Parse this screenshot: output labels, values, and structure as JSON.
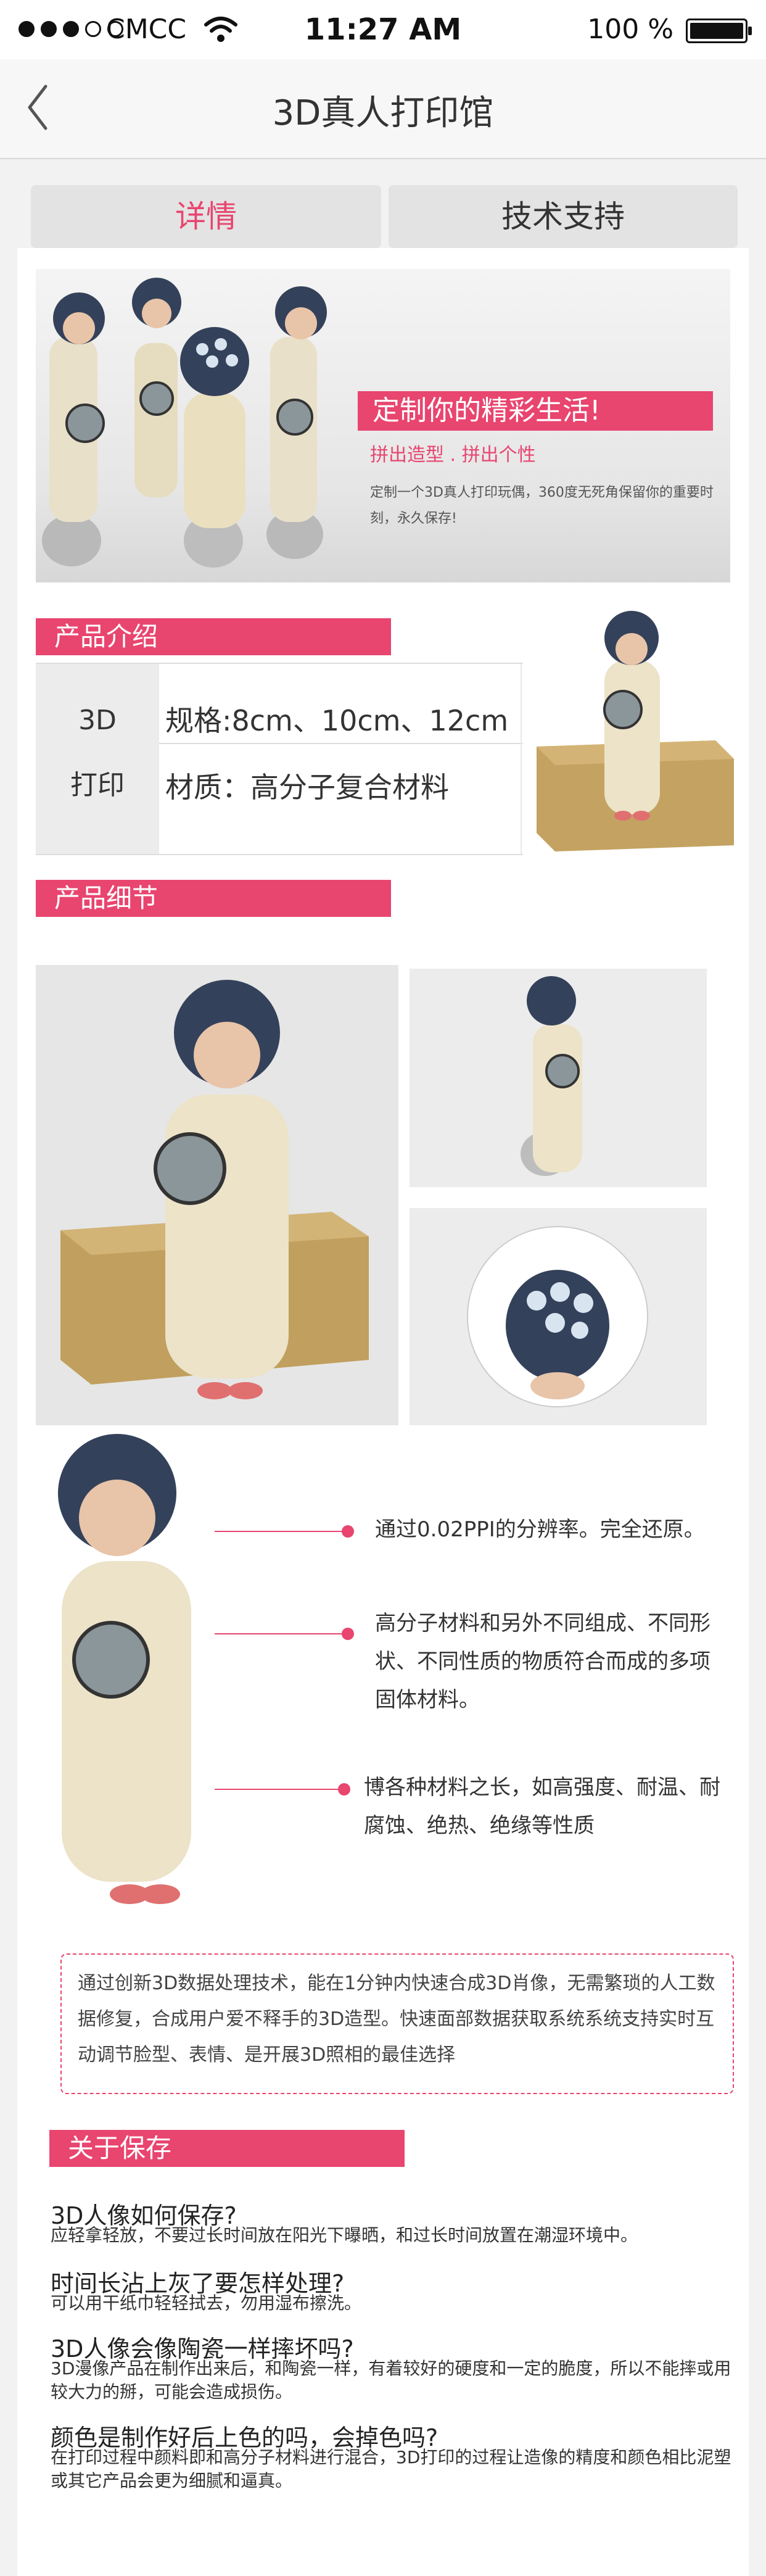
{
  "status_bar": {
    "carrier": "CMCC",
    "time": "11:27 AM",
    "battery": "100 %"
  },
  "nav": {
    "title": "3D真人打印馆"
  },
  "tabs": [
    {
      "label": "详情",
      "active": true
    },
    {
      "label": "技术支持",
      "active": false
    }
  ],
  "hero": {
    "slogan": "定制你的精彩生活!",
    "subtitle": "拼出造型 . 拼出个性",
    "description": "定制一个3D真人打印玩偶，360度无死角保留你的重要时刻，永久保存!"
  },
  "product_intro": {
    "header": "产品介绍",
    "label_line1": "3D",
    "label_line2": "打印",
    "spec_size": "规格:8cm、10cm、12cm",
    "spec_material": "材质：高分子复合材料"
  },
  "product_detail": {
    "header": "产品细节"
  },
  "features": [
    "通过0.02PPI的分辨率。完全还原。",
    "高分子材料和另外不同组成、不同形状、不同性质的物质符合而成的多项固体材料。",
    "博各种材料之长，如高强度、耐温、耐腐蚀、绝热、绝缘等性质"
  ],
  "note": "通过创新3D数据处理技术，能在1分钟内快速合成3D肖像，无需繁琐的人工数据修复，合成用户爱不释手的3D造型。快速面部数据获取系统系统支持实时互动调节脸型、表情、是开展3D照相的最佳选择",
  "storage": {
    "header": "关于保存",
    "qa": [
      {
        "q": "3D人像如何保存?",
        "a": "应轻拿轻放，不要过长时间放在阳光下曝晒，和过长时间放置在潮湿环境中。"
      },
      {
        "q": "时间长沾上灰了要怎样处理?",
        "a": "可以用干纸巾轻轻拭去，勿用湿布擦洗。"
      },
      {
        "q": "3D人像会像陶瓷一样摔坏吗?",
        "a": "3D漫像产品在制作出来后，和陶瓷一样，有着较好的硬度和一定的脆度，所以不能摔或用较大力的掰，可能会造成损伤。"
      },
      {
        "q": "颜色是制作好后上色的吗，会掉色吗?",
        "a": "在打印过程中颜料即和高分子材料进行混合，3D打印的过程让造像的精度和颜色相比泥塑或其它产品会更为细腻和逼真。"
      }
    ]
  },
  "colors": {
    "accent": "#e8456f",
    "background": "#f2f2f2"
  }
}
